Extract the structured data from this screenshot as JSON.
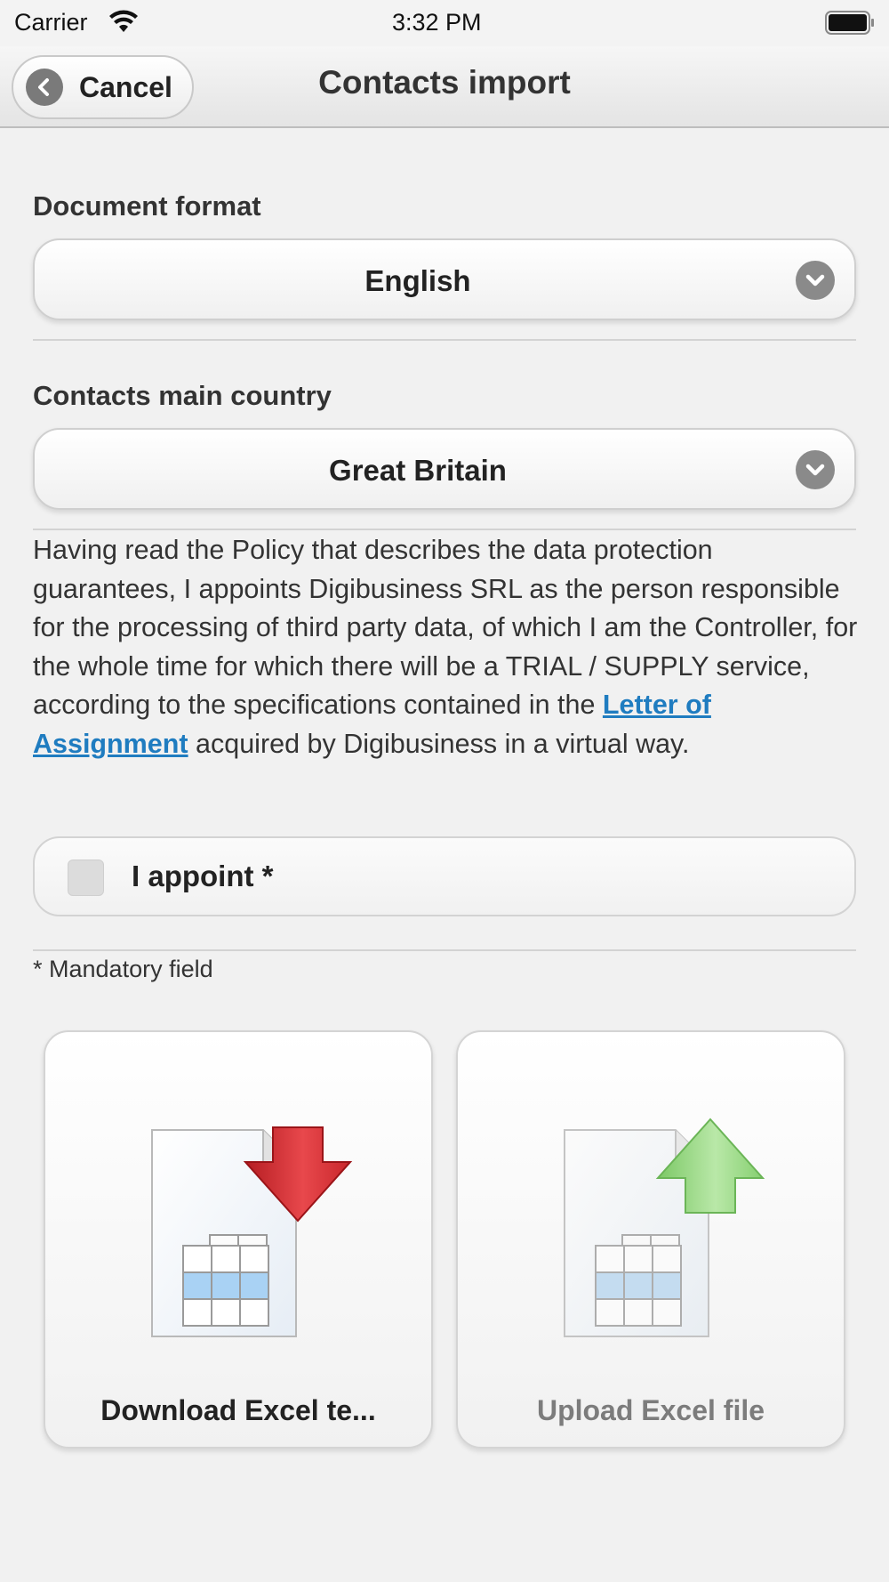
{
  "status_bar": {
    "carrier": "Carrier",
    "time": "3:32 PM"
  },
  "nav": {
    "cancel_label": "Cancel",
    "title": "Contacts import"
  },
  "form": {
    "document_format": {
      "label": "Document format",
      "value": "English"
    },
    "main_country": {
      "label": "Contacts main country",
      "value": "Great Britain"
    },
    "policy": {
      "text_before": "Having read the Policy that describes the data protection guarantees, I appoints Digibusiness SRL as the person responsible for the processing of third party data, of which I am the Controller, for the whole time for which there will be a TRIAL / SUPPLY service, according to the specifications contained in the ",
      "link_text": "Letter of Assignment",
      "text_after": " acquired by Digibusiness in a virtual way."
    },
    "appoint": {
      "label": "I appoint *",
      "checked": false
    },
    "mandatory_note": "* Mandatory field"
  },
  "actions": {
    "download_label": "Download Excel te...",
    "upload_label": "Upload Excel file"
  },
  "icons": {
    "cancel": "chevron-left-icon",
    "select_arrow": "chevron-down-icon",
    "download": "excel-download-icon",
    "upload": "excel-upload-icon"
  },
  "colors": {
    "link": "#1f7cc0",
    "download_arrow": "#d9272d",
    "upload_arrow": "#7cc866"
  }
}
